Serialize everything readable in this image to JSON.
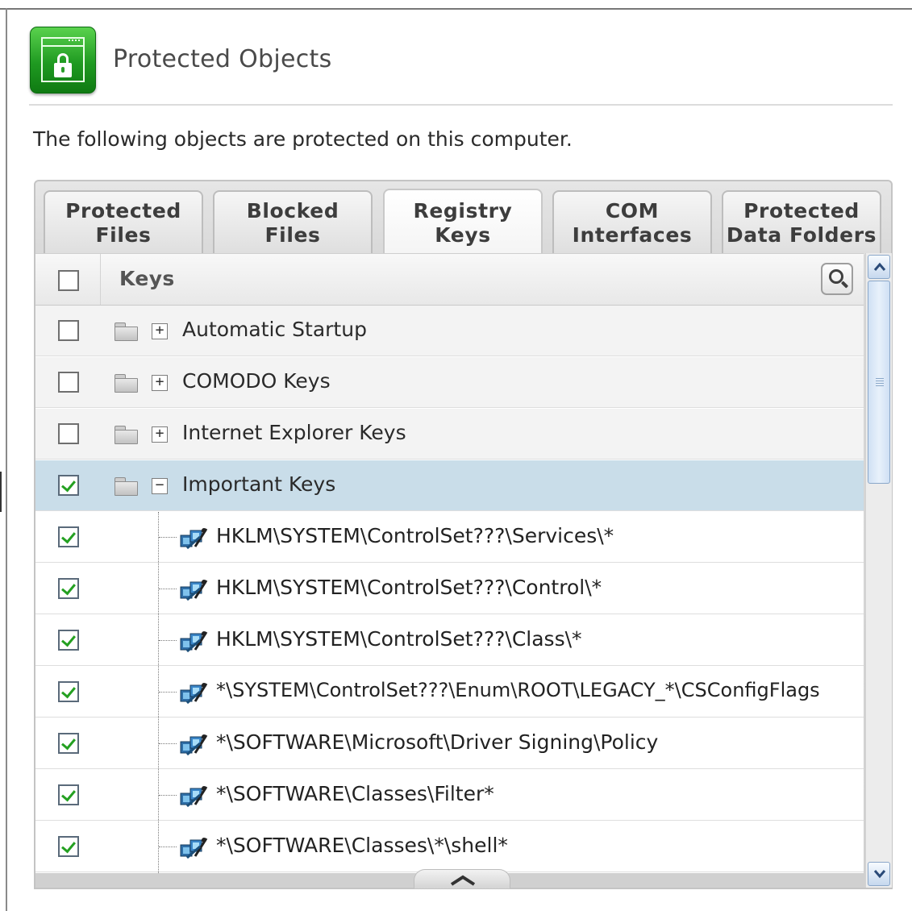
{
  "header": {
    "title": "Protected Objects",
    "description": "The following objects are protected on this computer."
  },
  "tabs": [
    {
      "line1": "Protected",
      "line2": "Files",
      "active": false
    },
    {
      "line1": "Blocked",
      "line2": "Files",
      "active": false
    },
    {
      "line1": "Registry",
      "line2": "Keys",
      "active": true
    },
    {
      "line1": "COM",
      "line2": "Interfaces",
      "active": false
    },
    {
      "line1": "Protected",
      "line2": "Data Folders",
      "active": false
    }
  ],
  "table": {
    "column_header": "Keys",
    "groups": [
      {
        "label": "Automatic Startup",
        "checked": false,
        "expanded": false,
        "expander": "+"
      },
      {
        "label": "COMODO Keys",
        "checked": false,
        "expanded": false,
        "expander": "+"
      },
      {
        "label": "Internet Explorer Keys",
        "checked": false,
        "expanded": false,
        "expander": "+"
      },
      {
        "label": "Important Keys",
        "checked": true,
        "expanded": true,
        "expander": "−"
      }
    ],
    "children": [
      {
        "label": "HKLM\\SYSTEM\\ControlSet???\\Services\\*",
        "checked": true
      },
      {
        "label": "HKLM\\SYSTEM\\ControlSet???\\Control\\*",
        "checked": true
      },
      {
        "label": "HKLM\\SYSTEM\\ControlSet???\\Class\\*",
        "checked": true
      },
      {
        "label": "*\\SYSTEM\\ControlSet???\\Enum\\ROOT\\LEGACY_*\\CSConfigFlags",
        "checked": true
      },
      {
        "label": "*\\SOFTWARE\\Microsoft\\Driver Signing\\Policy",
        "checked": true
      },
      {
        "label": "*\\SOFTWARE\\Classes\\Filter*",
        "checked": true
      },
      {
        "label": "*\\SOFTWARE\\Classes\\*\\shell*",
        "checked": true
      }
    ]
  },
  "icons": {
    "app": "lock-window-icon",
    "folder": "folder-icon",
    "key": "registry-key-icon",
    "search": "search-icon"
  },
  "colors": {
    "app_icon_green": "#1f9a21",
    "selected_row": "#c9dde9",
    "checkmark": "#24a021"
  }
}
